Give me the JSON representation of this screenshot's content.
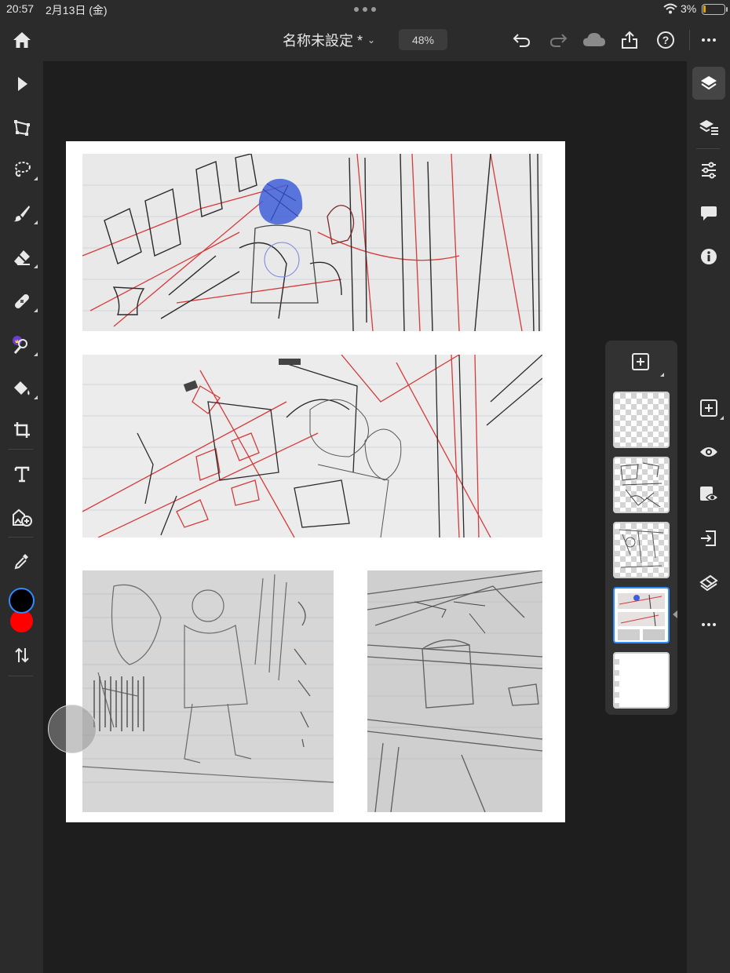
{
  "status_bar": {
    "time": "20:57",
    "date": "2月13日 (金)",
    "battery": "3%"
  },
  "topbar": {
    "document_title": "名称未設定 *",
    "zoom": "48%"
  },
  "colors": {
    "primary": "#000000",
    "secondary": "#ff0000",
    "selection_accent": "#2d8cff"
  },
  "left_tools": [
    "select",
    "transform",
    "lasso",
    "brush",
    "eraser",
    "healing",
    "magic-wand",
    "fill",
    "crop",
    "text",
    "add-image",
    "eyedropper",
    "swap-colors"
  ],
  "right_tools": [
    "layers",
    "layer-properties",
    "adjustments",
    "comments",
    "info",
    "add-layer",
    "visibility",
    "mask-visibility",
    "import",
    "clear",
    "more"
  ],
  "layers": [
    {
      "name": "layer-5",
      "kind": "transparent"
    },
    {
      "name": "layer-4",
      "kind": "sketch-dense"
    },
    {
      "name": "layer-3",
      "kind": "sketch-light"
    },
    {
      "name": "layer-2",
      "kind": "photo",
      "selected": true
    },
    {
      "name": "layer-1",
      "kind": "white"
    }
  ]
}
